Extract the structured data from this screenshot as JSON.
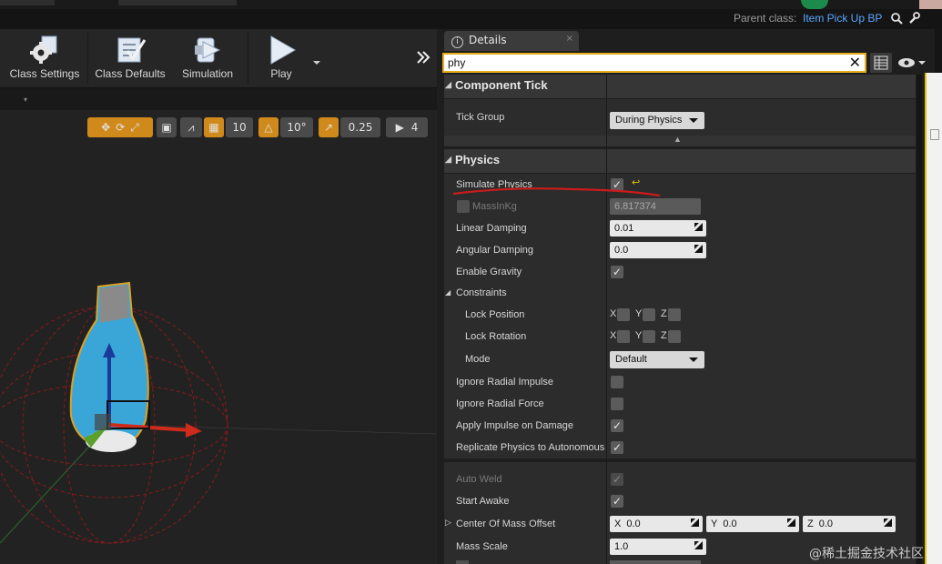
{
  "header": {
    "parent_class_label": "Parent class:",
    "parent_class_value": "Item Pick Up BP"
  },
  "toolbar": {
    "buttons": [
      {
        "label": "Class Settings",
        "icon": "gear-icon"
      },
      {
        "label": "Class Defaults",
        "icon": "checklist-icon"
      },
      {
        "label": "Simulation",
        "icon": "simulation-icon"
      },
      {
        "label": "Play",
        "icon": "play-icon"
      }
    ],
    "overflow_icon": "double-chevron-icon"
  },
  "viewport": {
    "grid_snap": "10",
    "rotation_snap": "10°",
    "scale_snap": "0.25",
    "camera_speed": "4"
  },
  "details": {
    "tab_label": "Details",
    "search_value": "phy",
    "categories": {
      "component_tick": "Component Tick",
      "physics": "Physics"
    },
    "tick_group": {
      "label": "Tick Group",
      "value": "During Physics"
    },
    "simulate_physics": {
      "label": "Simulate Physics",
      "checked": true
    },
    "mass": {
      "label": "MassInKg",
      "value": "6.817374"
    },
    "linear_damping": {
      "label": "Linear Damping",
      "value": "0.01"
    },
    "angular_damping": {
      "label": "Angular Damping",
      "value": "0.0"
    },
    "enable_gravity": {
      "label": "Enable Gravity",
      "checked": true
    },
    "constraints": {
      "label": "Constraints"
    },
    "lock_position": {
      "label": "Lock Position",
      "axes": [
        "X",
        "Y",
        "Z"
      ]
    },
    "lock_rotation": {
      "label": "Lock Rotation",
      "axes": [
        "X",
        "Y",
        "Z"
      ]
    },
    "mode": {
      "label": "Mode",
      "value": "Default"
    },
    "ignore_radial_impulse": {
      "label": "Ignore Radial Impulse",
      "checked": false
    },
    "ignore_radial_force": {
      "label": "Ignore Radial Force",
      "checked": false
    },
    "apply_impulse_on_damage": {
      "label": "Apply Impulse on Damage",
      "checked": true
    },
    "replicate_physics": {
      "label": "Replicate Physics to Autonomous",
      "checked": true
    },
    "auto_weld": {
      "label": "Auto Weld",
      "checked": true
    },
    "start_awake": {
      "label": "Start Awake",
      "checked": true
    },
    "center_of_mass_offset": {
      "label": "Center Of Mass Offset",
      "x": "0.0",
      "y": "0.0",
      "z": "0.0",
      "x_label": "X",
      "y_label": "Y",
      "z_label": "Z"
    },
    "mass_scale": {
      "label": "Mass Scale",
      "value": "1.0"
    }
  },
  "watermark": "@稀土掘金技术社区",
  "colors": {
    "accent_orange": "#d08a1c",
    "search_border": "#e6ac1d",
    "link_blue": "#5ba6ff"
  }
}
